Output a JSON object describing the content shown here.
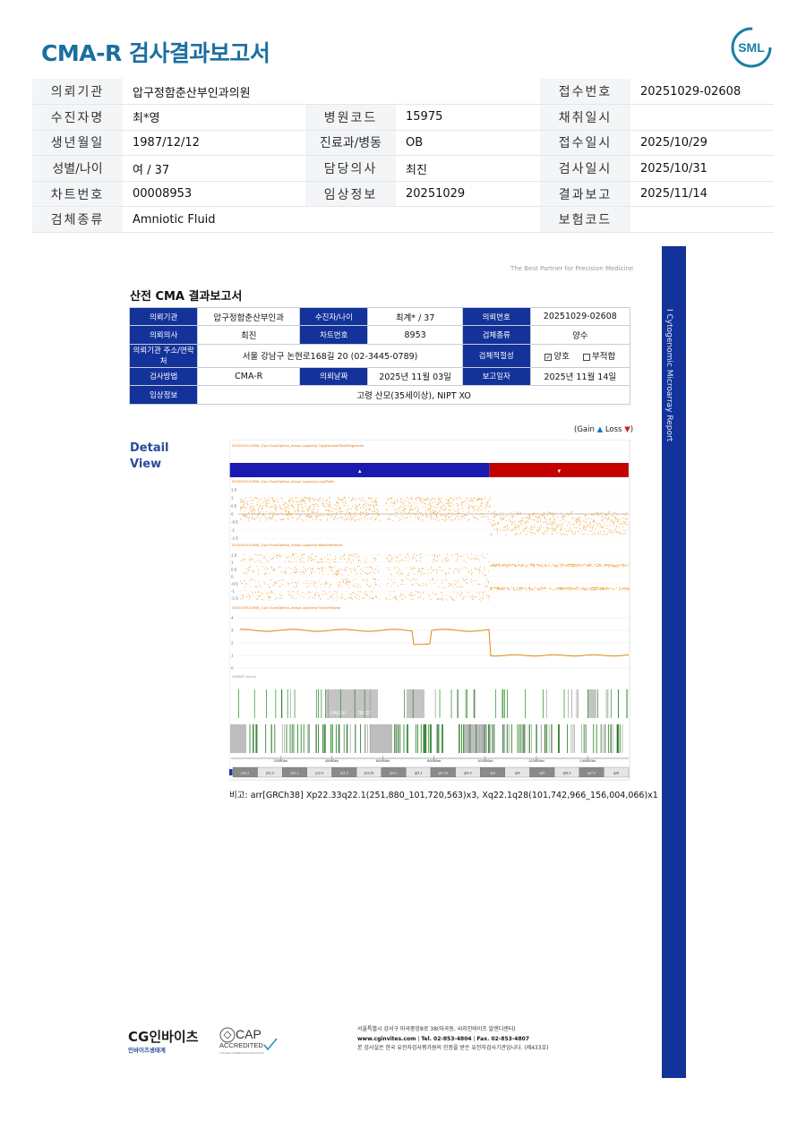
{
  "page_title": "CMA-R 검사결과보고서",
  "logo_text": "SML",
  "header": {
    "r1": {
      "l1": "의뢰기관",
      "v1": "압구정함춘산부인과의원",
      "l3": "접수번호",
      "v3": "20251029-02608"
    },
    "r2": {
      "l1": "수진자명",
      "v1": "최*영",
      "l2": "병원코드",
      "v2": "15975",
      "l3": "채취일시",
      "v3": ""
    },
    "r3": {
      "l1": "생년월일",
      "v1": "1987/12/12",
      "l2": "진료과/병동",
      "v2": "OB",
      "l3": "접수일시",
      "v3": "2025/10/29"
    },
    "r4": {
      "l1": "성별/나이",
      "v1": "여 / 37",
      "l2": "담당의사",
      "v2": "최진",
      "l3": "검사일시",
      "v3": "2025/10/31"
    },
    "r5": {
      "l1": "차트번호",
      "v1": "00008953",
      "l2": "임상정보",
      "v2": "20251029",
      "l3": "결과보고",
      "v3": "2025/11/14"
    },
    "r6": {
      "l1": "검체종류",
      "v1": "Amniotic Fluid",
      "l3": "보험코드",
      "v3": ""
    }
  },
  "sidebar_text": "I   Cytogenomic Microarray Report",
  "tagline": "The Best Partner for Precision Medicine",
  "report": {
    "title": "산전 CMA 결과보고서",
    "r1": {
      "l1": "의뢰기관",
      "v1": "압구정함춘산부인과",
      "l2": "수진자/나이",
      "v2": "최계* / 37",
      "l3": "의뢰번호",
      "v3": "20251029-02608"
    },
    "r2": {
      "l1": "의뢰의사",
      "v1": "최진",
      "l2": "차트번호",
      "v2": "8953",
      "l3": "검체종류",
      "v3": "양수"
    },
    "r3": {
      "l1": "의뢰기관 주소/연락처",
      "v1": "서울 강남구 논현로168길 20 (02-3445-0789)",
      "l3": "검체적절성",
      "ok": "양호",
      "ng": "부적합"
    },
    "r4": {
      "l1": "검사방법",
      "v1": "CMA-R",
      "l2": "의뢰날짜",
      "v2": "2025년 11월 03일",
      "l3": "보고일자",
      "v3": "2025년 11월 14일"
    },
    "r5": {
      "l1": "임상정보",
      "v1": "고령 산모(35세이상), NIPT XO"
    }
  },
  "detail": {
    "line1": "Detail",
    "line2": "View"
  },
  "legend": {
    "open": "(Gain",
    "gain_mark": "▲",
    "mid": "Loss",
    "loss_mark": "▼",
    "close": ")"
  },
  "remark": "비고: arr[GRCh38] Xp22.33q22.1(251,880_101,720,563)x3, Xq22.1q28(101,742,966_156,004,066)x1",
  "chart_data": {
    "type": "line",
    "chromosome": "X",
    "segments": [
      {
        "call": "gain",
        "mark": "▲",
        "start": 251880,
        "end": 101720563,
        "copy_number": 3,
        "color": "#1a1ab0"
      },
      {
        "call": "loss",
        "mark": "▼",
        "start": 101742966,
        "end": 156004066,
        "copy_number": 1,
        "color": "#c40000"
      }
    ],
    "log2_ticks": [
      "1.5",
      "1",
      "0.5",
      "0",
      "-0.5",
      "-1",
      "-1.5"
    ],
    "allele_ticks": [
      "1.5",
      "1",
      "0.5",
      "0",
      "-0.5",
      "-1",
      "-1.5"
    ],
    "smooth_ticks": [
      "4",
      "3",
      "2",
      "1",
      "0"
    ],
    "coordinate_ticks": [
      "20000kb",
      "40000kb",
      "60000kb",
      "80000kb",
      "100000kb",
      "120000kb",
      "140000kb"
    ],
    "smooth_signal": {
      "gain_level": 3,
      "loss_level": 1
    },
    "point_color": "#f0a030",
    "band_labels": [
      "p22.2",
      "p21.3",
      "p21.1",
      "p11.4",
      "p11.3",
      "p11.23",
      "q13.1",
      "q21.1",
      "q21.32",
      "q22.2",
      "q23",
      "q24",
      "q25",
      "q26.3",
      "q27.3",
      "q28"
    ],
    "region_labels": [
      "SAGE6",
      "TBX22"
    ],
    "track_titles": [
      "20251029-02608_Cyto ScanOptima_Array1.cyoptchp CopyNumberStateSegments",
      "20251029-02608_Cyto ScanOptima_Array1.cyoptchp Log2Ratio",
      "20251029-02608_Cyto ScanOptima_Array1.cyoptchp AlleleDifference",
      "20251029-02608_Cyto ScanOptima_Array1.cyoptchp SmoothSignal",
      "OMIM® Genes"
    ]
  },
  "footer": {
    "brand": "CG인바이츠",
    "brand_sub": "인바이츠생태계",
    "cap_title": "CAP",
    "cap_sub": "ACCREDITED",
    "cap_note": "COLLEGE of AMERICAN PATHOLOGISTS",
    "addr": "서울특별시 강서구 마곡중앙8로 38(마곡동, 씨지인바이츠 알엔디센터)",
    "web": "www.cginvites.com",
    "tel": "Tel. 02-853-4804",
    "fax": "Fax. 02-853-4807",
    "cert": "본 검사실은 한국 유전자검사평가원의 인증을 받은 유전자검사기관입니다. (제433호)"
  }
}
